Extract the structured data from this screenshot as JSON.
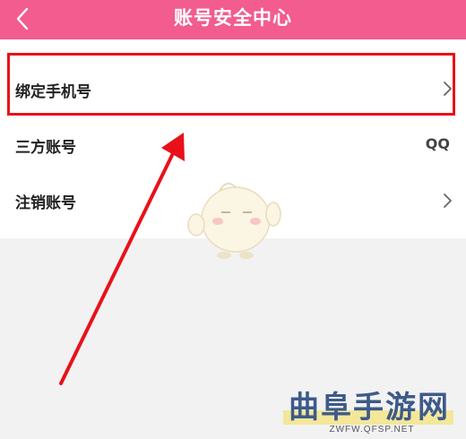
{
  "header": {
    "title": "账号安全中心",
    "background_color": "#f25c8e",
    "back_icon": "chevron-left-icon"
  },
  "list": {
    "items": [
      {
        "label": "绑定手机号",
        "value": "",
        "icon": "chevron-right-icon"
      },
      {
        "label": "三方账号",
        "value": "QQ",
        "icon": ""
      },
      {
        "label": "注销账号",
        "value": "",
        "icon": "chevron-right-icon"
      }
    ]
  },
  "annotation": {
    "highlight_color": "#e8111a",
    "arrow_color": "#e8111a"
  },
  "watermark": {
    "brand": "曲阜手游网",
    "url": "ZWFW.QFSP.NET"
  }
}
